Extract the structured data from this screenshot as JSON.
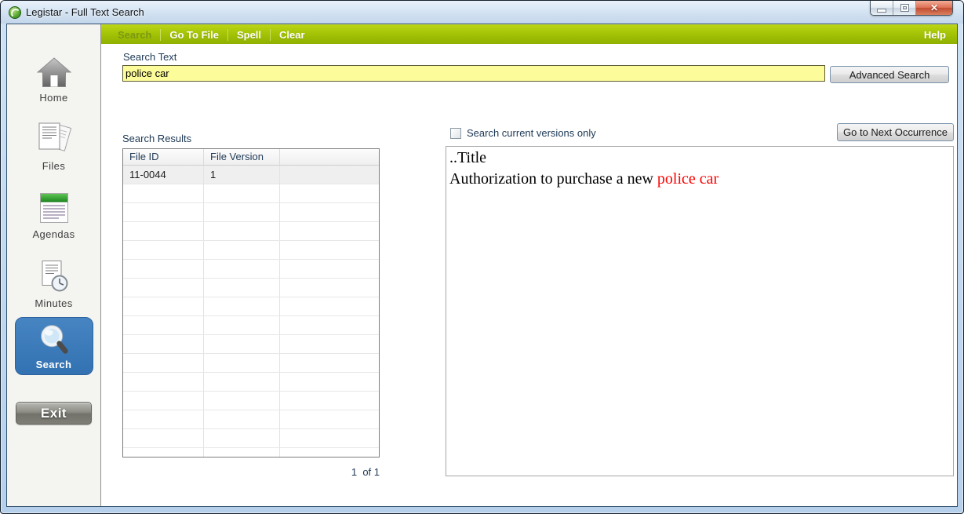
{
  "window": {
    "title": "Legistar - Full Text Search"
  },
  "menubar": {
    "items": [
      {
        "label": "Search",
        "disabled": true
      },
      {
        "label": "Go To File",
        "disabled": false
      },
      {
        "label": "Spell",
        "disabled": false
      },
      {
        "label": "Clear",
        "disabled": false
      }
    ],
    "help_label": "Help"
  },
  "sidebar": {
    "items": [
      {
        "label": "Home"
      },
      {
        "label": "Files"
      },
      {
        "label": "Agendas"
      },
      {
        "label": "Minutes"
      },
      {
        "label": "Search",
        "active": true
      }
    ],
    "exit_label": "Exit"
  },
  "search": {
    "label": "Search Text",
    "value": "police car",
    "advanced_button": "Advanced Search"
  },
  "results": {
    "label": "Search Results",
    "columns": [
      "File ID",
      "File Version",
      ""
    ],
    "rows": [
      {
        "file_id": "11-0044",
        "file_version": "1"
      }
    ],
    "visible_row_slots": 16,
    "pager": "1  of 1"
  },
  "viewer": {
    "checkbox_label": "Search current versions only",
    "checkbox_checked": false,
    "next_button": "Go to Next Occurrence",
    "document": {
      "line1": "..Title",
      "line2_prefix": "Authorization to purchase a new ",
      "highlight": "police car"
    }
  },
  "colors": {
    "menubar_green": "#a4c407",
    "search_input_bg": "#fdfc9a",
    "active_sidebar_blue": "#3372b2",
    "highlight_red": "#fe0000",
    "frame_blue": "#b6d0ec"
  }
}
